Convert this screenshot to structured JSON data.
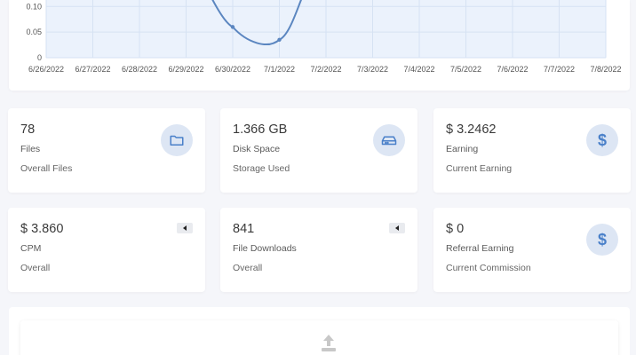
{
  "chart_data": {
    "type": "line",
    "x": [
      "6/26/2022",
      "6/27/2022",
      "6/28/2022",
      "6/29/2022",
      "6/30/2022",
      "7/1/2022",
      "7/2/2022",
      "7/3/2022",
      "7/4/2022",
      "7/5/2022",
      "7/6/2022",
      "7/7/2022",
      "7/8/2022"
    ],
    "y_ticks": [
      "0",
      "0.05",
      "0.10"
    ],
    "visible_points": [
      {
        "x": "6/30/2022",
        "y": 0.06
      },
      {
        "x": "7/1/2022",
        "y": 0.035
      }
    ],
    "ylim": [
      0,
      0.13
    ],
    "grid": true,
    "colors": {
      "line": "#5b86c0",
      "fill": "#ebf2fc",
      "grid": "#d6e2f3"
    }
  },
  "stats": [
    {
      "value": "78",
      "label": "Files",
      "sub": "Overall Files",
      "icon": "folder-icon"
    },
    {
      "value": "1.366 GB",
      "label": "Disk Space",
      "sub": "Storage Used",
      "icon": "hard-drive-icon"
    },
    {
      "value": "$ 3.2462",
      "label": "Earning",
      "sub": "Current Earning",
      "icon": "dollar-icon",
      "glyph": "$"
    },
    {
      "value": "$ 3.860",
      "label": "CPM",
      "sub": "Overall",
      "icon": "caret-left-icon"
    },
    {
      "value": "841",
      "label": "File Downloads",
      "sub": "Overall",
      "icon": "caret-left-icon"
    },
    {
      "value": "$ 0",
      "label": "Referral Earning",
      "sub": "Current Commission",
      "icon": "dollar-icon",
      "glyph": "$"
    }
  ],
  "upload": {
    "icon": "upload-icon"
  },
  "colors": {
    "accent": "#4a80c9",
    "icon_bg": "#dde6f4",
    "page_bg": "#f5f6fa"
  }
}
